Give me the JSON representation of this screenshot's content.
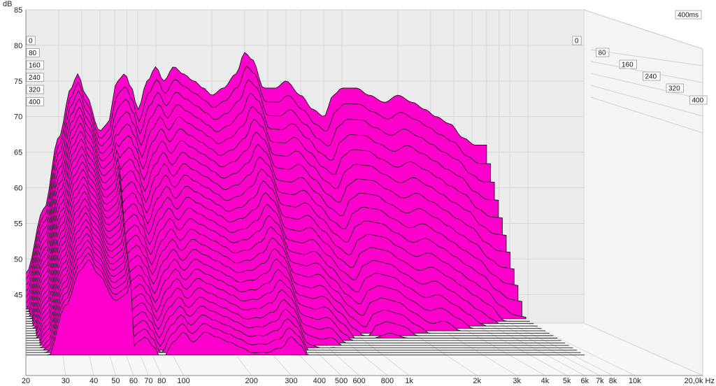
{
  "chart_data": {
    "type": "waterfall",
    "title": "",
    "ylabel": "dB",
    "xlabel_unit": "Hz",
    "x_scale": "log",
    "xlim": [
      20,
      20000
    ],
    "ylim": [
      41,
      85
    ],
    "time_label": "400ms",
    "y_ticks": [
      "85",
      "80",
      "75",
      "70",
      "65",
      "60",
      "55",
      "50",
      "45"
    ],
    "x_ticks": [
      {
        "f": 20,
        "label": "20"
      },
      {
        "f": 30,
        "label": "30"
      },
      {
        "f": 40,
        "label": "40"
      },
      {
        "f": 50,
        "label": "50"
      },
      {
        "f": 60,
        "label": "60"
      },
      {
        "f": 70,
        "label": "70"
      },
      {
        "f": 80,
        "label": "80"
      },
      {
        "f": 100,
        "label": "100"
      },
      {
        "f": 200,
        "label": "200"
      },
      {
        "f": 300,
        "label": "300"
      },
      {
        "f": 400,
        "label": "400"
      },
      {
        "f": 500,
        "label": "500"
      },
      {
        "f": 600,
        "label": "600"
      },
      {
        "f": 800,
        "label": "800"
      },
      {
        "f": 1000,
        "label": "1k"
      },
      {
        "f": 2000,
        "label": "2k"
      },
      {
        "f": 3000,
        "label": "3k"
      },
      {
        "f": 4000,
        "label": "4k"
      },
      {
        "f": 5000,
        "label": "5k"
      },
      {
        "f": 6000,
        "label": "6k"
      },
      {
        "f": 7000,
        "label": "7k"
      },
      {
        "f": 8000,
        "label": "8k"
      },
      {
        "f": 10000,
        "label": "10k"
      },
      {
        "f": 20000,
        "label": "20,0k Hz"
      }
    ],
    "time_ticks_ms": [
      "0",
      "80",
      "160",
      "240",
      "320",
      "400"
    ],
    "time_range_ms": [
      0,
      400
    ],
    "fill_color": "#ff00cc",
    "line_color": "#1a1a1a",
    "first_slice_response": [
      {
        "f": 20,
        "db": 48
      },
      {
        "f": 25,
        "db": 57
      },
      {
        "f": 30,
        "db": 67
      },
      {
        "f": 35,
        "db": 74
      },
      {
        "f": 38,
        "db": 76
      },
      {
        "f": 42,
        "db": 73
      },
      {
        "f": 50,
        "db": 68
      },
      {
        "f": 55,
        "db": 69
      },
      {
        "f": 62,
        "db": 75
      },
      {
        "f": 68,
        "db": 76
      },
      {
        "f": 74,
        "db": 74
      },
      {
        "f": 80,
        "db": 71
      },
      {
        "f": 90,
        "db": 75
      },
      {
        "f": 100,
        "db": 77
      },
      {
        "f": 110,
        "db": 75
      },
      {
        "f": 125,
        "db": 77
      },
      {
        "f": 140,
        "db": 76
      },
      {
        "f": 160,
        "db": 75
      },
      {
        "f": 180,
        "db": 74
      },
      {
        "f": 200,
        "db": 73
      },
      {
        "f": 230,
        "db": 74
      },
      {
        "f": 270,
        "db": 76
      },
      {
        "f": 300,
        "db": 79
      },
      {
        "f": 330,
        "db": 78
      },
      {
        "f": 380,
        "db": 74
      },
      {
        "f": 440,
        "db": 74
      },
      {
        "f": 500,
        "db": 75
      },
      {
        "f": 600,
        "db": 73
      },
      {
        "f": 700,
        "db": 71
      },
      {
        "f": 800,
        "db": 70
      },
      {
        "f": 900,
        "db": 73
      },
      {
        "f": 1000,
        "db": 74
      },
      {
        "f": 1200,
        "db": 74
      },
      {
        "f": 1400,
        "db": 73
      },
      {
        "f": 1700,
        "db": 72
      },
      {
        "f": 2000,
        "db": 73
      },
      {
        "f": 2400,
        "db": 72
      },
      {
        "f": 2800,
        "db": 71
      },
      {
        "f": 3200,
        "db": 70
      },
      {
        "f": 3800,
        "db": 69
      },
      {
        "f": 4500,
        "db": 67
      },
      {
        "f": 5200,
        "db": 66
      },
      {
        "f": 6000,
        "db": 66
      }
    ],
    "decay_db_per_slice": 1.1,
    "slices": 26
  }
}
